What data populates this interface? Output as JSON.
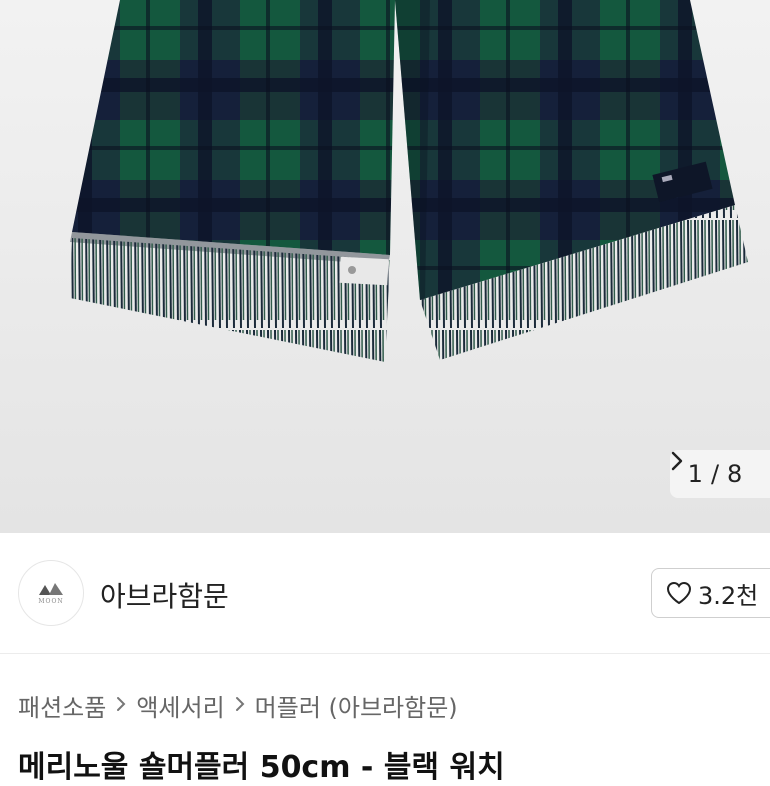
{
  "hero": {
    "image_alt": "black watch tartan scarf product photo",
    "counter": {
      "current": "1",
      "separator": "/",
      "total": "8",
      "next_icon": "chevron-right-icon"
    }
  },
  "seller": {
    "avatar_logo_text": "MOON",
    "name": "아브라함문",
    "like_icon": "heart-outline-icon",
    "like_count": "3.2천"
  },
  "breadcrumb": {
    "items": [
      "패션소품",
      "액세서리",
      "머플러 (아브라함문)"
    ]
  },
  "product": {
    "title": "메리노울 숄머플러 50cm - 블랙 워치"
  }
}
